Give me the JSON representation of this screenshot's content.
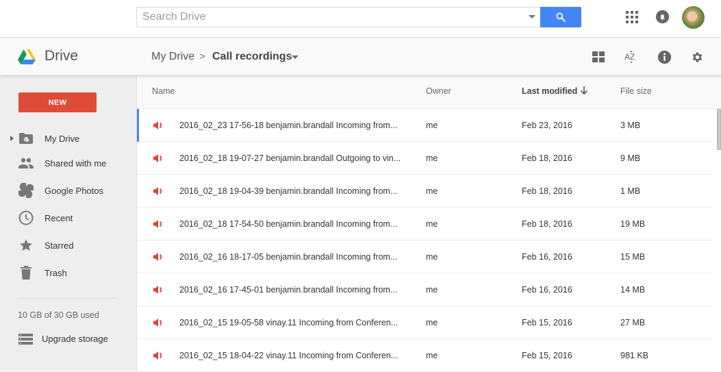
{
  "topbar": {
    "search_placeholder": "Search Drive",
    "search_value": "",
    "icons": {
      "search_button": "search-icon",
      "apps": "apps-grid-icon",
      "notifications": "bell-icon",
      "avatar": "user-avatar"
    },
    "accent_color": "#4285f4"
  },
  "subbar": {
    "app_name": "Drive",
    "breadcrumb": {
      "root": "My Drive",
      "separator": ">",
      "current": "Call recordings"
    },
    "tools": [
      "grid-view-icon",
      "sort-az-icon",
      "info-icon",
      "settings-gear-icon"
    ]
  },
  "sidebar": {
    "new_button": "NEW",
    "new_button_color": "#dd4b39",
    "items": [
      {
        "label": "My Drive",
        "icon": "my-drive-folder-icon"
      },
      {
        "label": "Shared with me",
        "icon": "people-icon"
      },
      {
        "label": "Google Photos",
        "icon": "pinwheel-icon"
      },
      {
        "label": "Recent",
        "icon": "clock-icon"
      },
      {
        "label": "Starred",
        "icon": "star-icon"
      },
      {
        "label": "Trash",
        "icon": "trash-icon"
      }
    ],
    "storage_text": "10 GB of 30 GB used",
    "upgrade_label": "Upgrade storage"
  },
  "list": {
    "columns": {
      "name": "Name",
      "owner": "Owner",
      "modified": "Last modified",
      "size": "File size"
    },
    "sort_column": "Last modified",
    "sort_direction": "descending",
    "file_icon": "audio-file-icon",
    "file_icon_color": "#db4437",
    "rows": [
      {
        "name": "2016_02_23 17-56-18 benjamin.brandall Incoming from...",
        "owner": "me",
        "modified": "Feb 23, 2016",
        "size": "3 MB",
        "selected": true
      },
      {
        "name": "2016_02_18 19-07-27 benjamin.brandall Outgoing to vin...",
        "owner": "me",
        "modified": "Feb 18, 2016",
        "size": "9 MB"
      },
      {
        "name": "2016_02_18 19-04-39 benjamin.brandall Incoming from...",
        "owner": "me",
        "modified": "Feb 18, 2016",
        "size": "1 MB"
      },
      {
        "name": "2016_02_18 17-54-50 benjamin.brandall Incoming from...",
        "owner": "me",
        "modified": "Feb 18, 2016",
        "size": "19 MB"
      },
      {
        "name": "2016_02_16 18-17-05 benjamin.brandall Incoming from...",
        "owner": "me",
        "modified": "Feb 16, 2016",
        "size": "15 MB"
      },
      {
        "name": "2016_02_16 17-45-01 benjamin.brandall Incoming from...",
        "owner": "me",
        "modified": "Feb 16, 2016",
        "size": "14 MB"
      },
      {
        "name": "2016_02_15 19-05-58 vinay.11 Incoming from Conferen...",
        "owner": "me",
        "modified": "Feb 15, 2016",
        "size": "27 MB"
      },
      {
        "name": "2016_02_15 18-04-22 vinay.11 Incoming from Conferen...",
        "owner": "me",
        "modified": "Feb 15, 2016",
        "size": "981 KB"
      }
    ]
  }
}
